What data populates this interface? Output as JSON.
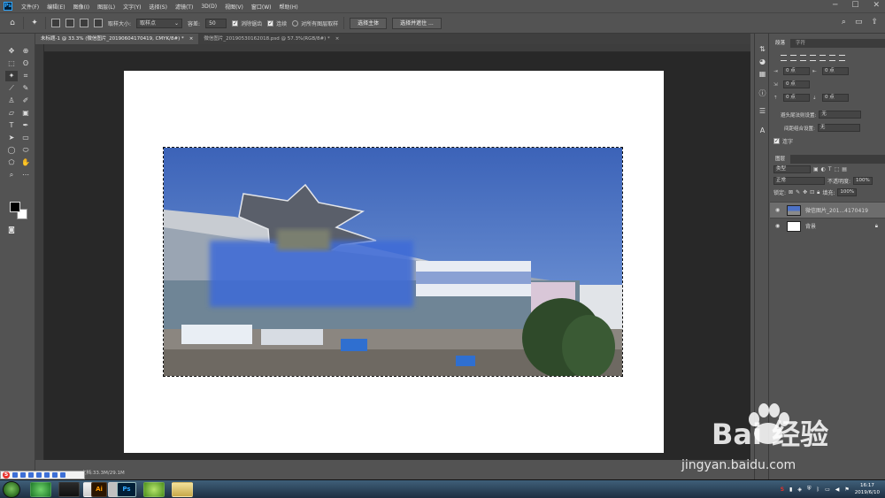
{
  "menu": {
    "logo": "Ps",
    "items": [
      "文件(F)",
      "编辑(E)",
      "图像(I)",
      "图层(L)",
      "文字(Y)",
      "选择(S)",
      "滤镜(T)",
      "3D(D)",
      "视图(V)",
      "窗口(W)",
      "帮助(H)"
    ]
  },
  "options": {
    "sample_size_label": "取样大小:",
    "sample_size_value": "取样点",
    "tolerance_label": "容差:",
    "tolerance_value": "50",
    "antialias_label": "消除锯齿",
    "contiguous_label": "连续",
    "all_layers_label": "对所有图层取样",
    "select_subject_button": "选择主体",
    "select_mask_button": "选择并遮住 ..."
  },
  "tabs": [
    {
      "label": "未标题-1 @ 33.3% (微信图片_20190604170419, CMYK/8#) *",
      "close": "×"
    },
    {
      "label": "微信图片_20190530162018.psd @ 57.3%(RGB/8#) *",
      "close": "×"
    }
  ],
  "status": {
    "doc_size": "文档:33.3M/29.1M"
  },
  "paragraph": {
    "tab_paragraph": "段落",
    "tab_character": "字符",
    "indent_values": [
      "0 点",
      "0 点",
      "0 点",
      "0 点",
      "0 点"
    ],
    "hyphen_label": "避头尾法则设置:",
    "hyphen_value": "无",
    "spacing_label": "间距组合设置:",
    "spacing_value": "无",
    "hyphenate_label": "连字"
  },
  "layers": {
    "tab_label": "图层",
    "filter_label": "类型",
    "blend_mode": "正常",
    "opacity_label": "不透明度:",
    "opacity_value": "100%",
    "lock_label": "锁定:",
    "fill_label": "填充:",
    "fill_value": "100%",
    "items": [
      {
        "name": "微信图片_201...4170419",
        "selected": true
      },
      {
        "name": "背景",
        "selected": false
      }
    ]
  },
  "taskbar": {
    "apps": [
      "",
      "",
      "",
      "",
      "Ai",
      "Ps",
      "",
      ""
    ],
    "time": "16:17",
    "date": "2019/6/10"
  },
  "watermark": {
    "text": "Bai 经验",
    "sub": "jingyan.baidu.com"
  },
  "colors": {
    "accent": "#31a8ff",
    "workspace": "#282828",
    "ui": "#535353"
  }
}
